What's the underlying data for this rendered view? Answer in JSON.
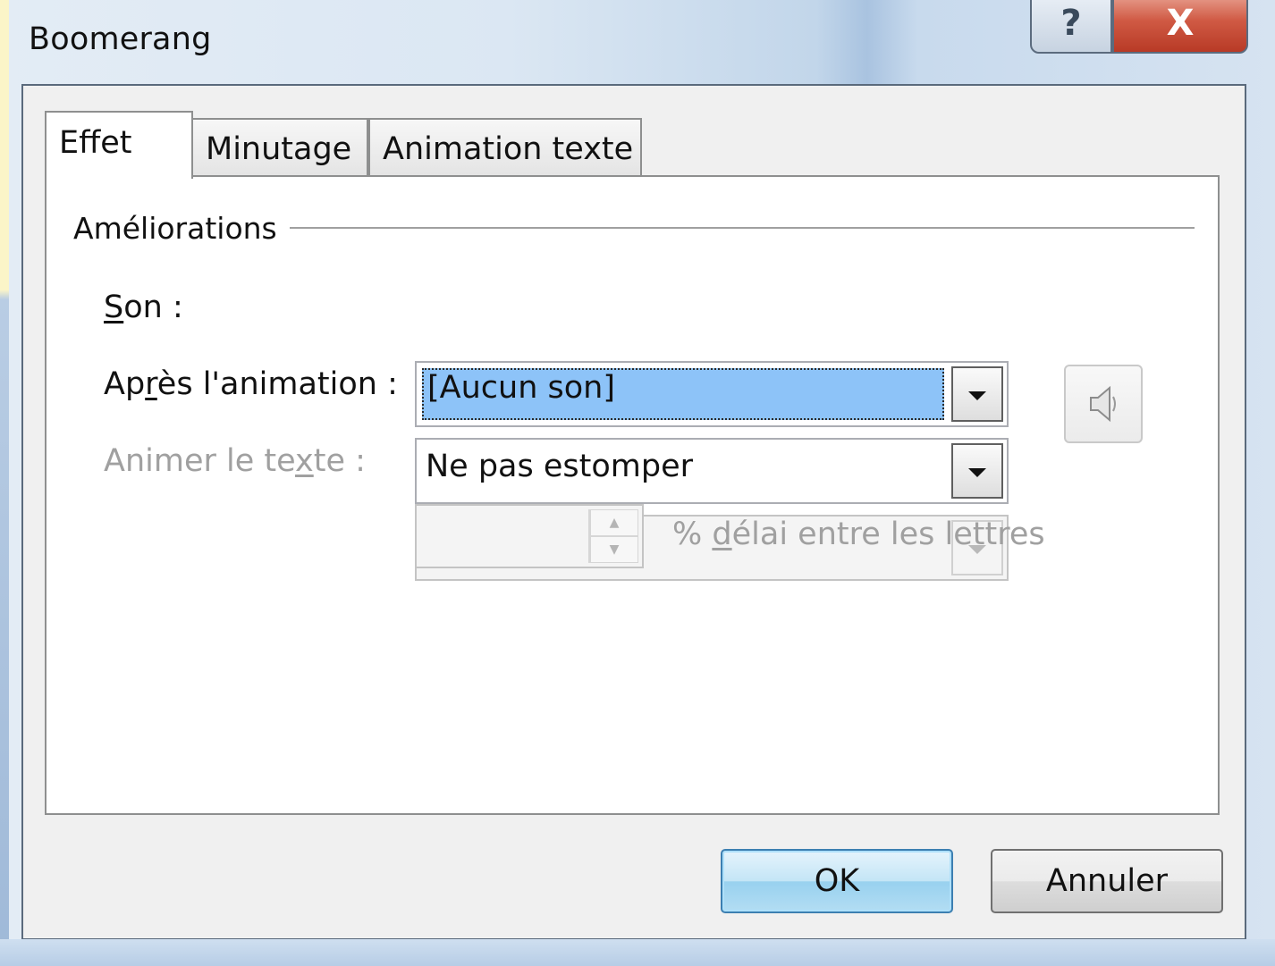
{
  "window": {
    "title": "Boomerang",
    "help_glyph": "?",
    "close_glyph": "X"
  },
  "tabs": [
    {
      "label": "Effet",
      "active": true
    },
    {
      "label": "Minutage",
      "active": false
    },
    {
      "label": "Animation texte",
      "active": false
    }
  ],
  "group": {
    "title": "Améliorations"
  },
  "fields": {
    "sound": {
      "label_pre": "",
      "label_ul": "S",
      "label_post": "on :",
      "value": "[Aucun son]"
    },
    "after_animation": {
      "label_pre": "Ap",
      "label_ul": "r",
      "label_post": "ès l'animation :",
      "value": "Ne pas estomper"
    },
    "animate_text": {
      "label_pre": "Animer le te",
      "label_ul": "x",
      "label_post": "te :",
      "value": ""
    },
    "delay": {
      "value": "",
      "label_pre": "% ",
      "label_ul": "d",
      "label_post": "élai entre les lettres"
    }
  },
  "buttons": {
    "ok": "OK",
    "cancel": "Annuler"
  },
  "colors": {
    "selection": "#8dc3f8",
    "ok_border": "#3c7fb1",
    "close_button": "#c8462f"
  }
}
